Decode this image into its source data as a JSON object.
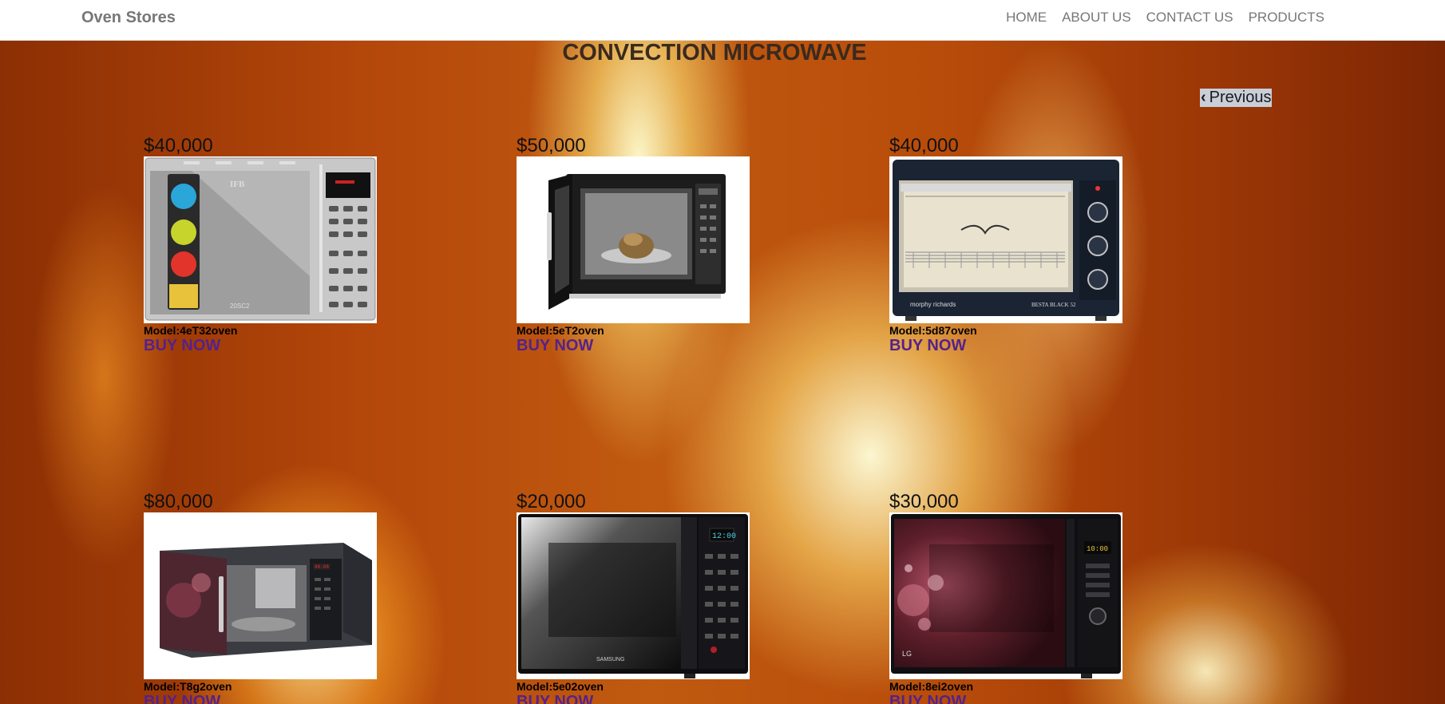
{
  "navbar": {
    "brand": "Oven Stores",
    "links": [
      "HOME",
      "ABOUT US",
      "CONTACT US",
      "PRODUCTS"
    ]
  },
  "page": {
    "title": "CONVECTION MICROWAVE",
    "prev_label": "Previous"
  },
  "products": [
    {
      "price": "$40,000",
      "model": "Model:4eT32oven",
      "buy": "BUY NOW",
      "image": "silver-ifb-microwave"
    },
    {
      "price": "$50,000",
      "model": "Model:5eT2oven",
      "buy": "BUY NOW",
      "image": "open-door-microwave"
    },
    {
      "price": "$40,000",
      "model": "Model:5d87oven",
      "buy": "BUY NOW",
      "image": "morphy-richards-otg"
    },
    {
      "price": "$80,000",
      "model": "Model:T8g2oven",
      "buy": "BUY NOW",
      "image": "lg-floral-microwave-open"
    },
    {
      "price": "$20,000",
      "model": "Model:5e02oven",
      "buy": "BUY NOW",
      "image": "samsung-black-microwave"
    },
    {
      "price": "$30,000",
      "model": "Model:8ei2oven",
      "buy": "BUY NOW",
      "image": "lg-floral-microwave"
    }
  ],
  "image_text": {
    "ifb_logo": "IFB",
    "ifb_model": "20SC2",
    "morphy_logo": "morphy richards",
    "morphy_model": "BESTA BLACK 52",
    "samsung_logo": "SAMSUNG",
    "samsung_display": "12:00",
    "lg_display": "10:00",
    "lg_logo": "LG"
  }
}
